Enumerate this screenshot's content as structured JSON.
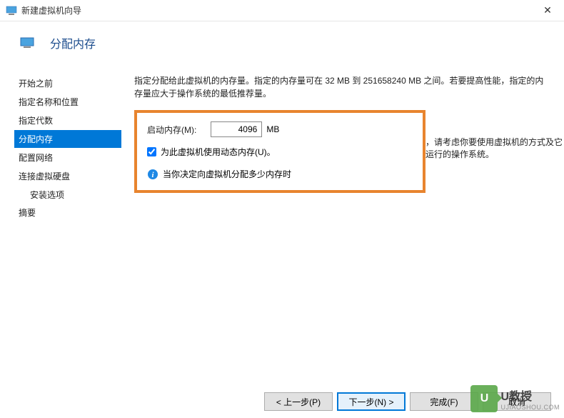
{
  "titlebar": {
    "title": "新建虚拟机向导"
  },
  "header": {
    "title": "分配内存"
  },
  "sidebar": {
    "items": [
      {
        "label": "开始之前"
      },
      {
        "label": "指定名称和位置"
      },
      {
        "label": "指定代数"
      },
      {
        "label": "分配内存"
      },
      {
        "label": "配置网络"
      },
      {
        "label": "连接虚拟硬盘"
      },
      {
        "label": "摘要"
      }
    ],
    "subitem": "安装选项"
  },
  "content": {
    "desc": "指定分配给此虚拟机的内存量。指定的内存量可在 32 MB 到 251658240 MB 之间。若要提高性能，指定的内存量应大于操作系统的最低推荐量。",
    "startup_label": "启动内存(M):",
    "startup_value": "4096",
    "unit": "MB",
    "dynmem_label": "为此虚拟机使用动态内存(U)。",
    "info_text": "当你决定向虚拟机分配多少内存时",
    "info_after": "，请考虑你要使用虚拟机的方式及它运行的操作系统。"
  },
  "footer": {
    "prev": "< 上一步(P)",
    "next": "下一步(N) >",
    "finish": "完成(F)",
    "cancel": "取消"
  },
  "watermark": {
    "line1": "U教授",
    "line2": "UJIAOSHOU.COM"
  }
}
